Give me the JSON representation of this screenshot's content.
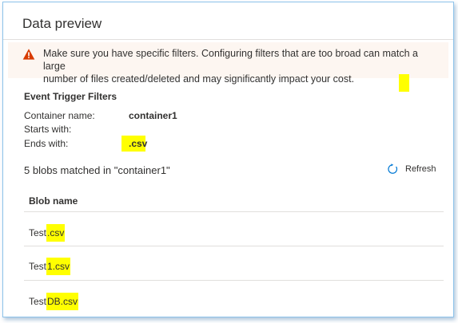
{
  "panel": {
    "title": "Data preview"
  },
  "warning": {
    "icon": "warning-triangle-icon",
    "color": "#d83b01",
    "line1": "Make sure you have specific filters. Configuring filters that are too broad can match a large",
    "line2": "number of files created/deleted and may significantly impact your cost."
  },
  "filters": {
    "title": "Event Trigger Filters",
    "container_label": "Container name:",
    "container_value": "container1",
    "starts_with_label": "Starts with:",
    "starts_with_value": "",
    "ends_with_label": "Ends with:",
    "ends_with_value": ".csv"
  },
  "results": {
    "summary": "5 blobs matched in \"container1\"",
    "refresh_label": "Refresh",
    "refresh_icon": "refresh-icon",
    "column_header": "Blob name",
    "blobs": [
      {
        "prefix": "Test",
        "match": ".csv"
      },
      {
        "prefix": "Test",
        "match": "1.csv"
      },
      {
        "prefix": "Test",
        "match": "DB.csv"
      }
    ]
  },
  "colors": {
    "highlight": "#ffff00",
    "warning_background": "#fdf6f1",
    "accent": "#0078d4",
    "border": "#8ec3ea"
  }
}
